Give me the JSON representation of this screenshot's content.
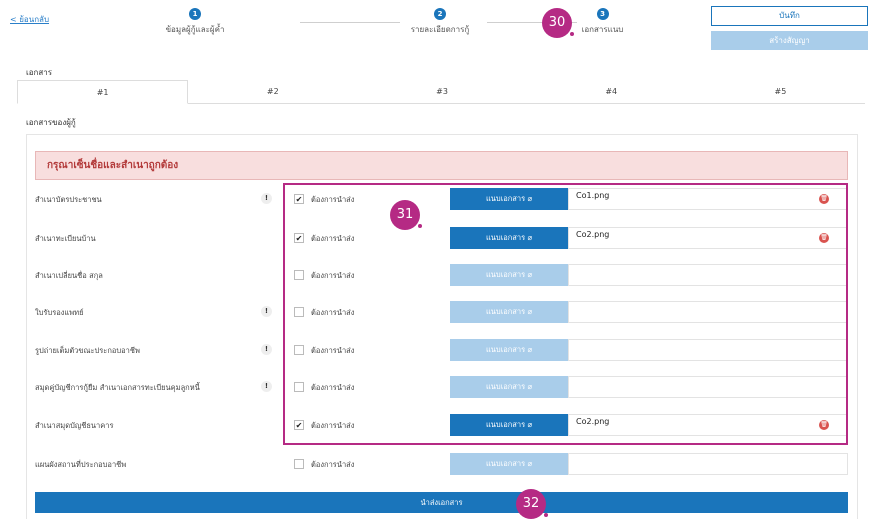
{
  "header": {
    "back_label": "< ย้อนกลับ",
    "steps": [
      {
        "number": "1",
        "label": "ข้อมูลผู้กู้และผู้ค้ำ"
      },
      {
        "number": "2",
        "label": "รายละเอียดการกู้"
      },
      {
        "number": "3",
        "label": "เอกสารแนบ"
      }
    ],
    "save_label": "บันทึก",
    "create_label": "สร้างสัญญา"
  },
  "section_title": "เอกสาร",
  "tabs": [
    "#1",
    "#2",
    "#3",
    "#4",
    "#5"
  ],
  "active_tab": "#1",
  "doc_owner_label": "เอกสารของผู้กู้",
  "alert_text": "กรุณาเซ็นชื่อและสำเนาถูกต้อง",
  "rows": [
    {
      "label": "สำเนาบัตรประชาชน",
      "info": "!",
      "checked": true,
      "check_label": "ต้องการนำส่ง",
      "upload_label": "แนบเอกสาร",
      "file": "Co1.png"
    },
    {
      "label": "สำเนาทะเบียนบ้าน",
      "info": "",
      "checked": true,
      "check_label": "ต้องการนำส่ง",
      "upload_label": "แนบเอกสาร",
      "file": "Co2.png"
    },
    {
      "label": "สำเนาเปลี่ยนชื่อ สกุล",
      "info": "",
      "checked": false,
      "check_label": "ต้องการนำส่ง",
      "upload_label": "แนบเอกสาร",
      "file": ""
    },
    {
      "label": "ใบรับรองแพทย์",
      "info": "!",
      "checked": false,
      "check_label": "ต้องการนำส่ง",
      "upload_label": "แนบเอกสาร",
      "file": ""
    },
    {
      "label": "รูปถ่ายเต็มตัวขณะประกอบอาชีพ",
      "info": "!",
      "checked": false,
      "check_label": "ต้องการนำส่ง",
      "upload_label": "แนบเอกสาร",
      "file": ""
    },
    {
      "label": "สมุดคู่บัญชีการกู้ยืม สำเนาเอกสารทะเบียนคุมลูกหนี้",
      "info": "!",
      "checked": false,
      "check_label": "ต้องการนำส่ง",
      "upload_label": "แนบเอกสาร",
      "file": ""
    },
    {
      "label": "สำเนาสมุดบัญชีธนาคาร",
      "info": "",
      "checked": true,
      "check_label": "ต้องการนำส่ง",
      "upload_label": "แนบเอกสาร",
      "file": "Co2.png"
    },
    {
      "label": "แผนผังสถานที่ประกอบอาชีพ",
      "info": "",
      "checked": false,
      "check_label": "ต้องการนำส่ง",
      "upload_label": "แนบเอกสาร",
      "file": ""
    }
  ],
  "submit_label": "นำส่งเอกสาร",
  "callouts": [
    "30",
    "31",
    "32"
  ],
  "colors": {
    "primary": "#1a75bb",
    "primary_disabled": "#a9cdea",
    "alert_bg": "#f8dede",
    "alert_text": "#b33a3a",
    "callout": "#b52a84",
    "delete": "#d9534f"
  }
}
